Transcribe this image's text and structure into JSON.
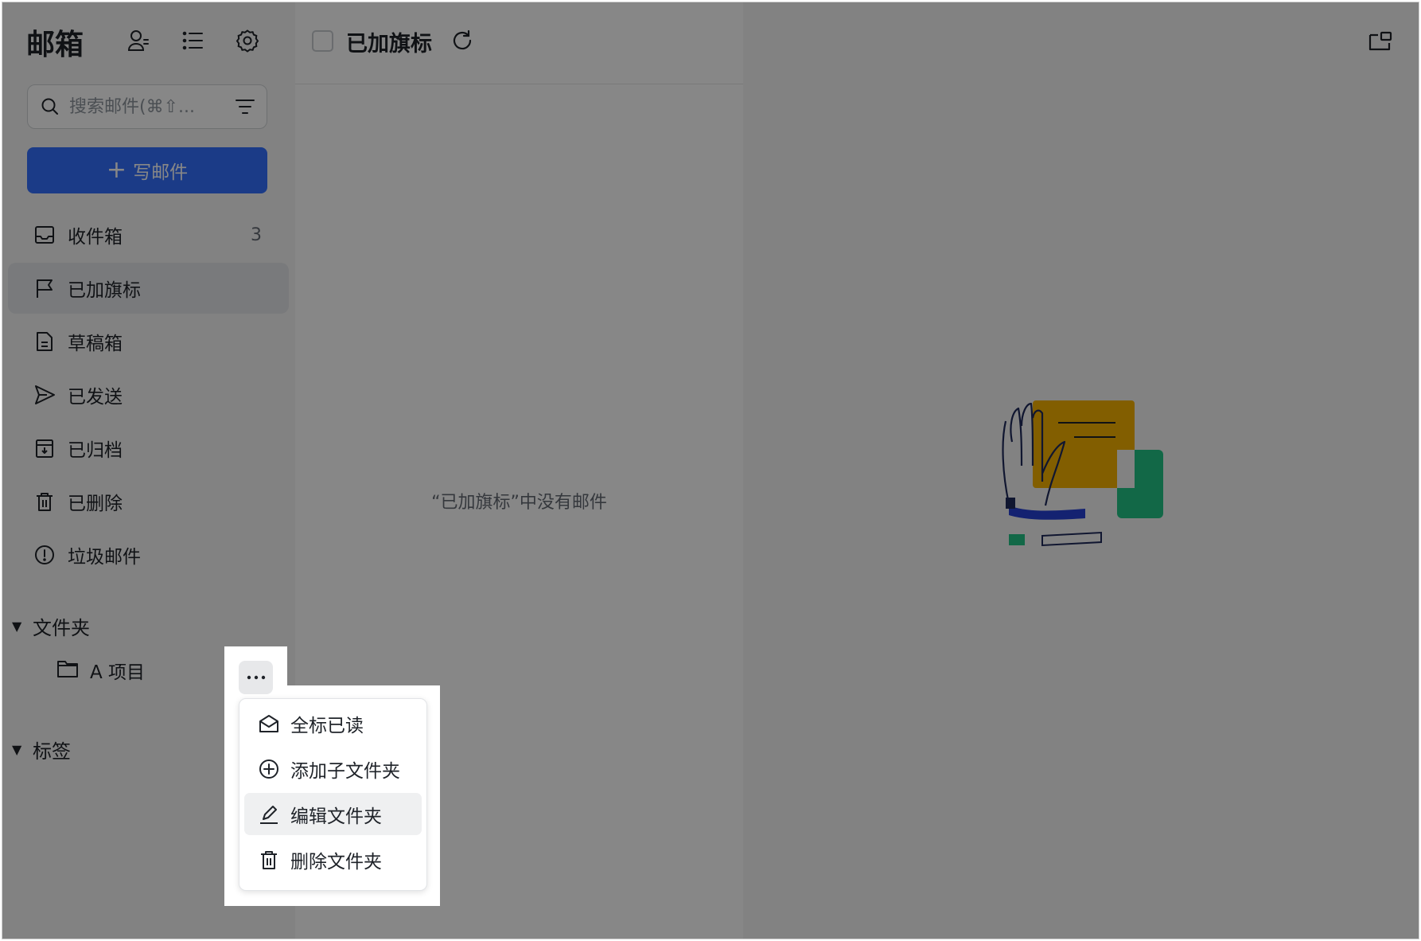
{
  "sidebar": {
    "title": "邮箱",
    "search": {
      "placeholder": "搜索邮件(⌘⇧...",
      "value": ""
    },
    "compose": {
      "icon": "+",
      "label": "写邮件"
    },
    "nav_items": [
      {
        "icon": "inbox-icon",
        "label": "收件箱",
        "count": "3"
      },
      {
        "icon": "flag-icon",
        "label": "已加旗标",
        "count": ""
      },
      {
        "icon": "draft-icon",
        "label": "草稿箱",
        "count": ""
      },
      {
        "icon": "send-icon",
        "label": "已发送",
        "count": ""
      },
      {
        "icon": "archive-icon",
        "label": "已归档",
        "count": ""
      },
      {
        "icon": "trash-icon",
        "label": "已删除",
        "count": ""
      },
      {
        "icon": "spam-icon",
        "label": "垃圾邮件",
        "count": ""
      }
    ],
    "active_item": "已加旗标",
    "folders_section": {
      "label": "文件夹",
      "items": [
        {
          "icon": "folder-icon",
          "label": "A 项目"
        }
      ]
    },
    "tags_section": {
      "label": "标签"
    }
  },
  "list": {
    "title": "已加旗标",
    "empty_message": "“已加旗标”中没有邮件"
  },
  "context_menu": {
    "trigger_icon": "more-icon",
    "items": [
      {
        "icon": "mark-read-icon",
        "label": "全标已读"
      },
      {
        "icon": "add-circle-icon",
        "label": "添加子文件夹"
      },
      {
        "icon": "edit-icon",
        "label": "编辑文件夹"
      },
      {
        "icon": "delete-icon",
        "label": "删除文件夹"
      }
    ],
    "highlighted_item": "编辑文件夹"
  },
  "colors": {
    "accent": "#3370ff",
    "text": "#1f2329",
    "muted": "#646a73",
    "sidebar_bg": "#f6f6f6",
    "active_bg": "#e5e7ea",
    "overlay": "rgba(0,0,0,0.47)"
  }
}
